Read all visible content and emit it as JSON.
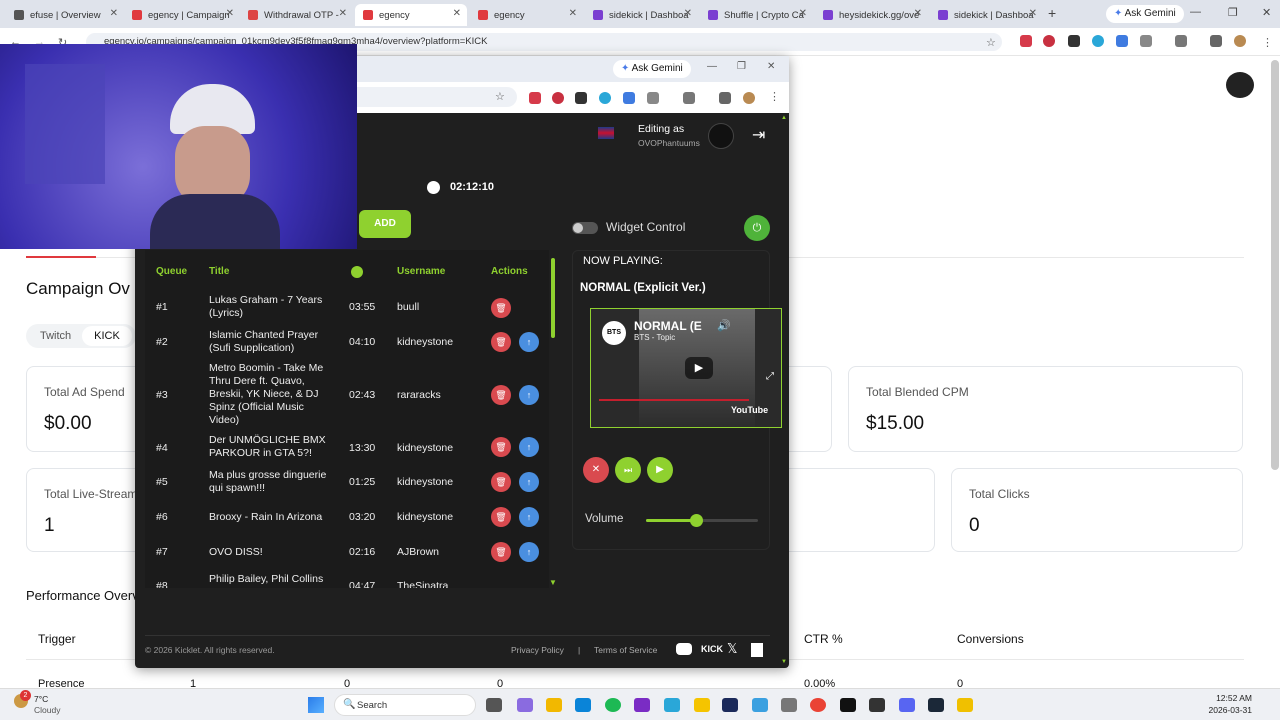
{
  "tabs": [
    {
      "label": "efuse | Overview",
      "color": "#555"
    },
    {
      "label": "egency | Campaign",
      "color": "#e0393e"
    },
    {
      "label": "Withdrawal OTP - ",
      "color": "#d44"
    },
    {
      "label": "egency",
      "color": "#e0393e"
    },
    {
      "label": "egency",
      "color": "#e0393e"
    },
    {
      "label": "sidekick | Dashboa",
      "color": "#7b3fd1"
    },
    {
      "label": "Shuffle | Crypto Ca",
      "color": "#7b3fd1"
    },
    {
      "label": "heysidekick.gg/ove",
      "color": "#7b3fd1"
    },
    {
      "label": "sidekick | Dashboa",
      "color": "#7b3fd1"
    }
  ],
  "ask_gemini": "Ask Gemini",
  "url": "egency.io/campaigns/campaign_01kcm9dey3f5f8fmag9gm3mha4/overview?platform=KICK",
  "page": {
    "campaign_title": "Campaign Ov",
    "platform_tabs": [
      "Twitch",
      "KICK"
    ],
    "metrics": [
      {
        "label": "Total Ad Spend",
        "value": "$0.00"
      },
      {
        "label": "Total Blended CPM",
        "value": "$15.00"
      },
      {
        "label": "Total Live-Stream",
        "value": "1"
      },
      {
        "label": "Total Clicks",
        "value": "0"
      }
    ],
    "performance_title": "Performance Overv",
    "table_headers": [
      "Trigger",
      "CTR %",
      "Conversions"
    ],
    "first_row": [
      "Presence",
      "1",
      "0",
      "0",
      "0.00%",
      "0"
    ]
  },
  "popup": {
    "ask_gemini": "Ask Gemini",
    "editing_as": "Editing as",
    "username": "OVOPhantuums",
    "timer": "02:12:10",
    "add_button": "ADD",
    "widget_control": "Widget Control",
    "queue_headers": {
      "queue": "Queue",
      "title": "Title",
      "username": "Username",
      "actions": "Actions"
    },
    "rows": [
      {
        "q": "#1",
        "title": "Lukas Graham - 7 Years (Lyrics)",
        "dur": "03:55",
        "user": "buull"
      },
      {
        "q": "#2",
        "title": "Islamic Chanted Prayer (Sufi Supplication)",
        "dur": "04:10",
        "user": "kidneystone"
      },
      {
        "q": "#3",
        "title": "Metro Boomin - Take Me Thru Dere ft. Quavo, Breskii, YK Niece, & DJ Spinz (Official Music Video)",
        "dur": "02:43",
        "user": "rararacks"
      },
      {
        "q": "#4",
        "title": "Der UNMÖGLICHE BMX PARKOUR in GTA 5?!",
        "dur": "13:30",
        "user": "kidneystone"
      },
      {
        "q": "#5",
        "title": "Ma plus grosse dinguerie qui spawn!!!",
        "dur": "01:25",
        "user": "kidneystone"
      },
      {
        "q": "#6",
        "title": "Brooxy - Rain In Arizona",
        "dur": "03:20",
        "user": "kidneystone"
      },
      {
        "q": "#7",
        "title": "OVO DISS!",
        "dur": "02:16",
        "user": "AJBrown"
      },
      {
        "q": "#8",
        "title": "Philip Bailey, Phil Collins",
        "dur": "04:47",
        "user": "TheSinatra"
      }
    ],
    "now_playing_label": "NOW PLAYING:",
    "now_playing_title": "NORMAL (Explicit Ver.)",
    "video_title": "NORMAL (E",
    "video_channel": "BTS - Topic",
    "video_badge": "BTS",
    "youtube": "YouTube",
    "volume_label": "Volume",
    "volume_level": 0.45,
    "footer_copyright": "© 2026 Kicklet. All rights reserved.",
    "privacy": "Privacy Policy",
    "separator": "|",
    "terms": "Terms of Service",
    "kick_logo": "KICK"
  },
  "taskbar": {
    "weather_temp": "7°C",
    "weather_desc": "Cloudy",
    "weather_badge": "2",
    "search": "Search",
    "time": "12:52 AM",
    "date": "2026-03-31"
  },
  "colors": {
    "accent_green": "#8fd12f",
    "delete_red": "#d94a4f",
    "move_blue": "#4a8fe0",
    "popup_bg": "#1f1f1f"
  }
}
